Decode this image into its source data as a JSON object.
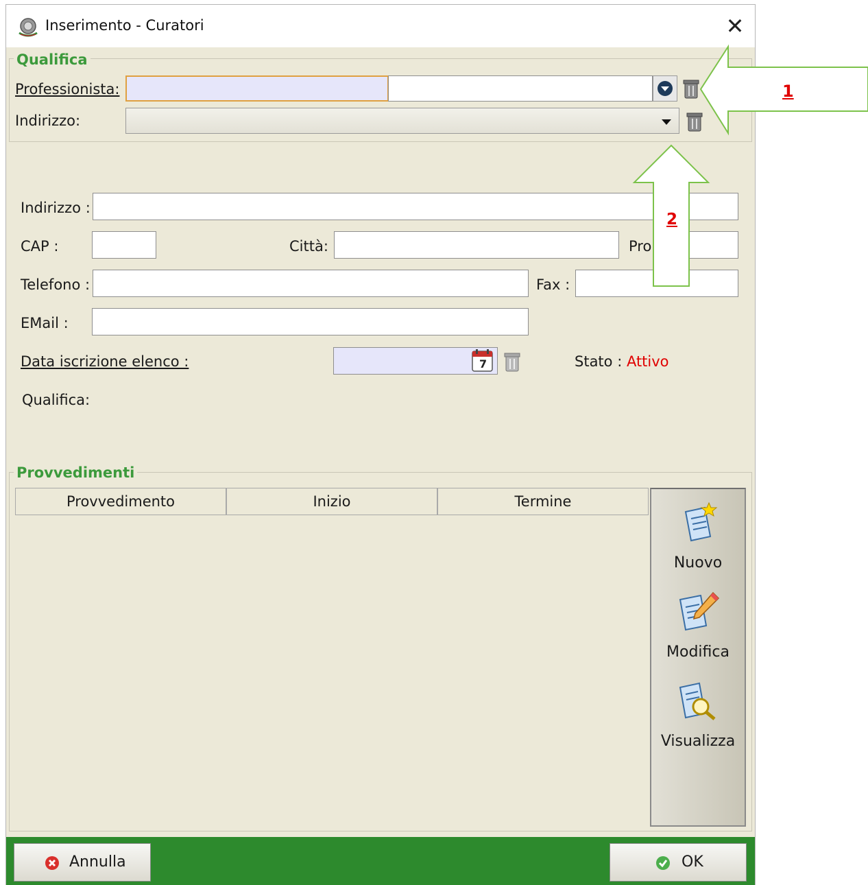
{
  "window": {
    "title": "Inserimento - Curatori",
    "close_glyph": "✕",
    "app_icon": "emblem-icon"
  },
  "qualifica_group": {
    "legend": "Qualifica",
    "professionista_label": "Professionista:",
    "professionista_value": "",
    "indirizzo_label": "Indirizzo:",
    "indirizzo_value": ""
  },
  "form": {
    "indirizzo_label": "Indirizzo :",
    "indirizzo_value": "",
    "cap_label": "CAP :",
    "cap_value": "",
    "citta_label": "Città:",
    "citta_value": "",
    "provincia_label": "Pro",
    "provincia_value": "",
    "telefono_label": "Telefono :",
    "telefono_value": "",
    "fax_label": "Fax :",
    "fax_value": "",
    "email_label": "EMail :",
    "email_value": "",
    "data_iscrizione_label": "Data iscrizione elenco :",
    "data_iscrizione_value": "",
    "calendar_day": "7",
    "stato_label": "Stato :",
    "stato_value": "Attivo",
    "qualifica_label": "Qualifica:"
  },
  "provvedimenti": {
    "legend": "Provvedimenti",
    "columns": [
      "Provvedimento",
      "Inizio",
      "Termine"
    ],
    "rows": [],
    "actions": [
      {
        "label": "Nuovo",
        "icon": "new-document-icon"
      },
      {
        "label": "Modifica",
        "icon": "edit-document-icon"
      },
      {
        "label": "Visualizza",
        "icon": "view-document-icon"
      }
    ]
  },
  "footer": {
    "cancel_label": "Annulla",
    "ok_label": "OK"
  },
  "annotations": {
    "arrow1_label": "1",
    "arrow2_label": "2"
  },
  "colors": {
    "legend_green": "#3c9a3c",
    "footer_green": "#2d8a2d",
    "status_red": "#e00000",
    "annotation_red": "#e00000",
    "highlight_field": "#e6e6fa",
    "arrow_stroke": "#7cc24a"
  }
}
